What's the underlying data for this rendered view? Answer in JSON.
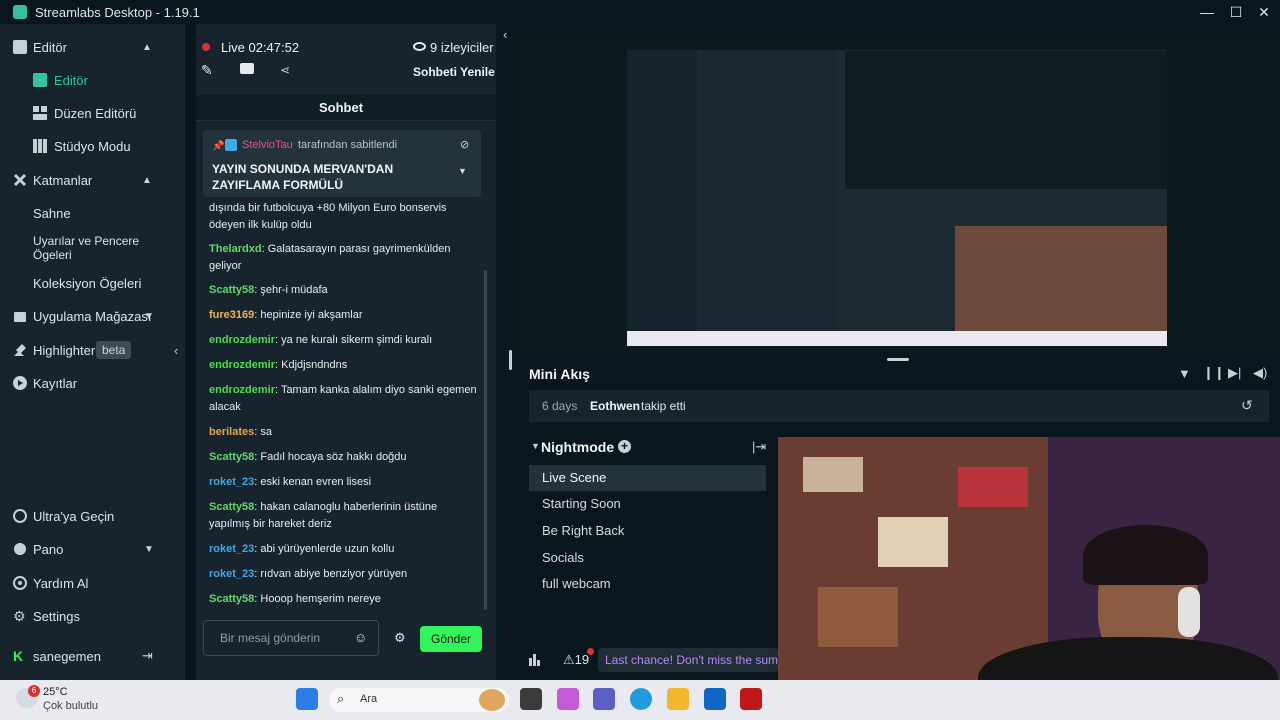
{
  "window": {
    "title": "Streamlabs Desktop - 1.19.1"
  },
  "sidebar": {
    "items": [
      {
        "label": "Editör",
        "icon": "editor-icon",
        "expanded": true
      },
      {
        "label": "Editör",
        "icon": "editor-sub-icon",
        "active": true
      },
      {
        "label": "Düzen Editörü",
        "icon": "layout-icon"
      },
      {
        "label": "Stüdyo Modu",
        "icon": "studio-icon"
      },
      {
        "label": "Katmanlar",
        "icon": "layers-icon",
        "expanded": true
      },
      {
        "label": "Sahne"
      },
      {
        "label": "Uyarılar ve Pencere Ögeleri"
      },
      {
        "label": "Koleksiyon Ögeleri"
      },
      {
        "label": "Uygulama Mağazası",
        "icon": "store-icon"
      },
      {
        "label": "Highlighter",
        "badge": "beta",
        "icon": "highlighter-icon"
      },
      {
        "label": "Kayıtlar",
        "icon": "recordings-icon"
      },
      {
        "label": "Ultra'ya Geçin",
        "icon": "ultra-icon"
      },
      {
        "label": "Pano",
        "icon": "dashboard-icon"
      },
      {
        "label": "Yardım Al",
        "icon": "help-icon"
      },
      {
        "label": "Settings",
        "icon": "gear-icon"
      },
      {
        "label": "sanegemen",
        "icon": "user-icon"
      }
    ]
  },
  "chat": {
    "status": {
      "live_label": "Live",
      "duration": "02:47:52",
      "viewers": "9 izleyiciler"
    },
    "refresh_label": "Sohbeti Yenile",
    "title": "Sohbet",
    "pinned": {
      "by": "StelvioTau",
      "note": "tarafından sabitlendi",
      "text": "YAYIN SONUNDA MERVAN'DAN ZAYIFLAMA FORMÜLÜ"
    },
    "messages": [
      {
        "text": "dışında bir futbolcuya +80 Milyon Euro bonservis ödeyen ilk kulüp oldu"
      },
      {
        "user": "Thelardxd",
        "text": "Galatasarayın parası gayrimenkülden geliyor",
        "color": "#63d66f"
      },
      {
        "user": "Scatty58",
        "text": "şehr-i müdafa",
        "color": "#63d66f"
      },
      {
        "user": "fure3169",
        "text": "hepinize iyi akşamlar",
        "color": "#f0b44c"
      },
      {
        "user": "endrozdemir",
        "text": "ya ne kuralı sikerm şimdi kuralı",
        "color": "#4ddc4d"
      },
      {
        "user": "endrozdemir",
        "text": "Kdjdjsndndns",
        "color": "#4ddc4d"
      },
      {
        "user": "endrozdemir",
        "text": "Tamam kanka alalım diyo sanki egemen alacak",
        "color": "#4ddc4d"
      },
      {
        "user": "berilates",
        "text": "sa",
        "color": "#e8a44c"
      },
      {
        "user": "Scatty58",
        "text": "Fadıl hocaya söz hakkı doğdu",
        "color": "#63d66f"
      },
      {
        "user": "roket_23",
        "text": "eski kenan evren lisesi",
        "color": "#3fa8e8"
      },
      {
        "user": "Scatty58",
        "text": "hakan calanoglu haberlerinin üstüne yapılmış bir hareket deriz",
        "color": "#63d66f"
      },
      {
        "user": "roket_23",
        "text": "abi yürüyenlerde uzun kollu",
        "color": "#3fa8e8"
      },
      {
        "user": "roket_23",
        "text": "rıdvan abiye benziyor yürüyen",
        "color": "#3fa8e8"
      },
      {
        "user": "Scatty58",
        "text": "Hooop hemşerim nereye",
        "color": "#63d66f"
      }
    ],
    "input_placeholder": "Bir mesaj gönderin",
    "send_label": "Gönder"
  },
  "mini_feed": {
    "title": "Mini Akış",
    "event": {
      "time": "6 days",
      "user": "Eothwen",
      "action": "takip etti"
    }
  },
  "scenes": {
    "collection": "Nightmode",
    "items": [
      "Live Scene",
      "Starting Soon",
      "Be Right Back",
      "Socials",
      "full webcam"
    ],
    "active_index": 0
  },
  "footer": {
    "alerts": "19",
    "banner": "Last chance! Don't miss the summ"
  },
  "taskbar": {
    "weather_temp": "25°C",
    "weather_desc": "Çok bulutlu",
    "badge": "6",
    "search": "Ara"
  }
}
